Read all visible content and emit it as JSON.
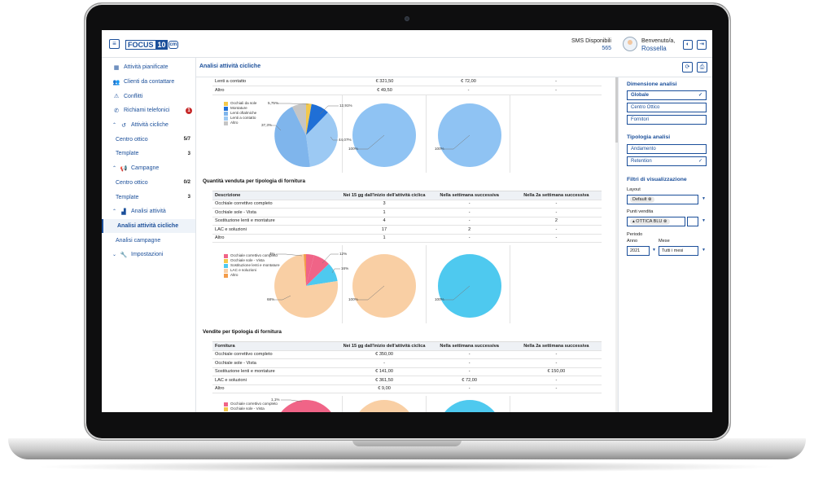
{
  "app": {
    "menu_icon": "hamburger-icon",
    "logo_part1": "FOCUS",
    "logo_part2": "10",
    "logo_part3": "cm"
  },
  "header": {
    "sms_label": "SMS Disponibili",
    "sms_count": "565",
    "welcome": "Benvenuto/a,",
    "user_name": "Rossella"
  },
  "sidebar": {
    "items": [
      {
        "label": "Attività pianificate",
        "icon": "calendar-icon"
      },
      {
        "label": "Clienti da contattare",
        "icon": "users-icon"
      },
      {
        "label": "Conflitti",
        "icon": "warning-icon"
      },
      {
        "label": "Richiami telefonici",
        "icon": "phone-icon",
        "badge": "1"
      },
      {
        "label": "Attività cicliche",
        "icon": "history-icon"
      },
      {
        "label": "Centro ottico",
        "badge": "5/7"
      },
      {
        "label": "Template",
        "badge": "3"
      },
      {
        "label": "Campagne",
        "icon": "megaphone-icon"
      },
      {
        "label": "Centro ottico",
        "badge": "0/2"
      },
      {
        "label": "Template",
        "badge": "3"
      },
      {
        "label": "Analisi attività",
        "icon": "chart-icon"
      },
      {
        "label": "Analisi attività cicliche"
      },
      {
        "label": "Analisi campagne"
      },
      {
        "label": "Impostazioni",
        "icon": "wrench-icon"
      }
    ]
  },
  "main": {
    "title": "Analisi attività cicliche"
  },
  "table1": {
    "rows": [
      [
        "Lenti a contatto",
        "€ 321,50",
        "€ 72,00",
        "-"
      ],
      [
        "Altro",
        "€ 49,50",
        "-",
        "-"
      ]
    ]
  },
  "chart1": {
    "legend": [
      "Occhiali da sole",
      "Montature",
      "Lenti oftalmiche",
      "Lenti a contatto",
      "Altro"
    ],
    "colors": [
      "#f3c84b",
      "#1f6fd6",
      "#7fb5ec",
      "#9cc9f3",
      "#c5c5c5"
    ],
    "labels": [
      "5,75%",
      "12,91%",
      "37,3%",
      "44,07%"
    ],
    "mid_label": "100%",
    "right_label": "100%"
  },
  "section2": {
    "title": "Quantità venduta per tipologia di fornitura"
  },
  "table2": {
    "headers": [
      "Descrizione",
      "Nei 15 gg dall'inizio dell'attività ciclica",
      "Nella settimana successiva",
      "Nella 2a settimana successiva"
    ],
    "rows": [
      [
        "Occhiale correttivo completo",
        "3",
        "-",
        "-"
      ],
      [
        "Occhiale sole - Vista",
        "1",
        "-",
        "-"
      ],
      [
        "Sostituzione lenti e montature",
        "4",
        "-",
        "2"
      ],
      [
        "LAC e soluzioni",
        "17",
        "2",
        "-"
      ],
      [
        "Altro",
        "1",
        "-",
        "-"
      ]
    ]
  },
  "chart2": {
    "legend": [
      "Occhiale correttivo completo",
      "Occhiale sole - Vista",
      "Sostituzione lenti e montature",
      "LAC e soluzioni",
      "Altro"
    ],
    "colors": [
      "#f06487",
      "#f3c84b",
      "#4ec9ef",
      "#f9cfa4",
      "#f39c4a"
    ],
    "labels": [
      "4%",
      "12%",
      "16%",
      "68%"
    ],
    "mid_label": "100%",
    "right_label": "100%"
  },
  "section3": {
    "title": "Vendite per tipologia di fornitura"
  },
  "table3": {
    "headers": [
      "Fornitura",
      "Nei 15 gg dall'inizio dell'attività ciclica",
      "Nella settimana successiva",
      "Nella 2a settimana successiva"
    ],
    "rows": [
      [
        "Occhiale correttivo completo",
        "€ 350,00",
        "-",
        "-"
      ],
      [
        "Occhiale sole - Vista",
        "-",
        "-",
        "-"
      ],
      [
        "Sostituzione lenti e montature",
        "€ 141,00",
        "-",
        "€ 150,00"
      ],
      [
        "LAC e soluzioni",
        "€ 361,50",
        "€ 72,00",
        "-"
      ],
      [
        "Altro",
        "€ 9,00",
        "-",
        "-"
      ]
    ]
  },
  "chart3": {
    "legend": [
      "Occhiale correttivo completo",
      "Occhiale sole - Vista"
    ],
    "label": "1,1%"
  },
  "panel": {
    "dim_title": "Dimensione analisi",
    "dim_options": [
      "Globale",
      "Centro Ottico",
      "Fornitori"
    ],
    "tipo_title": "Tipologia analisi",
    "tipo_options": [
      "Andamento",
      "Retention"
    ],
    "filtri_title": "Filtri di visualizzazione",
    "layout_label": "Layout",
    "layout_value": "Default",
    "pv_label": "Punti vendita",
    "pv_value": "OTTICA BLU",
    "periodo_label": "Periodo",
    "anno_label": "Anno",
    "anno_value": "2021",
    "mese_label": "Mese",
    "mese_value": "Tutti i mesi"
  }
}
